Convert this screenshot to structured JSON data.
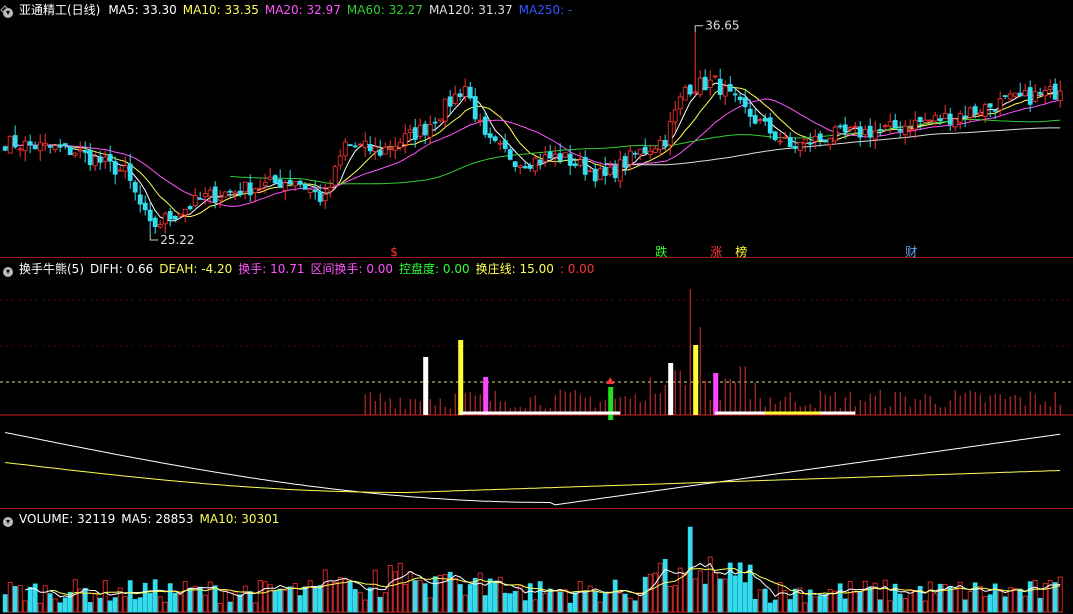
{
  "main": {
    "title": "亚通精工(日线)",
    "ma_labels": [
      {
        "label": "MA5: 33.30",
        "color": "#ffffff"
      },
      {
        "label": "MA10: 33.35",
        "color": "#ffff55"
      },
      {
        "label": "MA20: 32.97",
        "color": "#ff55ff"
      },
      {
        "label": "MA60: 32.27",
        "color": "#33cc33"
      },
      {
        "label": "MA120: 31.37",
        "color": "#dddddd"
      },
      {
        "label": "MA250: -",
        "color": "#3355ff"
      }
    ],
    "high_label": "36.65",
    "low_label": "25.22",
    "markers": [
      {
        "label": "$",
        "color": "#ff3333",
        "i": 78
      },
      {
        "label": "跌",
        "color": "#33ff33",
        "i": 131
      },
      {
        "label": "涨",
        "color": "#ff3333",
        "i": 142
      },
      {
        "label": "榜",
        "color": "#ffff33",
        "i": 147
      },
      {
        "label": "财",
        "color": "#66aaff",
        "i": 181
      }
    ]
  },
  "indicator": {
    "name": "换手牛熊(5)",
    "labels": [
      {
        "label": "DIFH: 0.66",
        "color": "#ffffff"
      },
      {
        "label": "DEAH: -4.20",
        "color": "#ffff55"
      },
      {
        "label": "换手: 10.71",
        "color": "#ff55ff"
      },
      {
        "label": "区间换手: 0.00",
        "color": "#ff55ff"
      },
      {
        "label": "控盘度: 0.00",
        "color": "#33ff33"
      },
      {
        "label": "换庄线: 15.00",
        "color": "#ffff55"
      },
      {
        "label": ": 0.00",
        "color": "#ff3333"
      }
    ]
  },
  "volume": {
    "labels": [
      {
        "label": "VOLUME: 32119",
        "color": "#ffffff"
      },
      {
        "label": "MA5: 28853",
        "color": "#ffffff"
      },
      {
        "label": "MA10: 30301",
        "color": "#ffff55"
      }
    ]
  },
  "icons": {
    "collapse": "chevron-down-icon",
    "scroll": "chevron-up-icon"
  },
  "chart_data": {
    "type": "candlestick",
    "title": "亚通精工(日线)",
    "bars": 212,
    "price_range": [
      25.22,
      36.65
    ],
    "anchors": [
      {
        "i": 0,
        "close": 30.4
      },
      {
        "i": 14,
        "close": 29.9
      },
      {
        "i": 24,
        "close": 28.7
      },
      {
        "i": 29,
        "close": 25.6
      },
      {
        "i": 40,
        "close": 27.3
      },
      {
        "i": 50,
        "close": 27.9
      },
      {
        "i": 58,
        "close": 28.3
      },
      {
        "i": 64,
        "close": 27.1
      },
      {
        "i": 68,
        "close": 30.3
      },
      {
        "i": 75,
        "close": 29.9
      },
      {
        "i": 84,
        "close": 31.2
      },
      {
        "i": 92,
        "close": 33.6
      },
      {
        "i": 96,
        "close": 30.5
      },
      {
        "i": 103,
        "close": 29.3
      },
      {
        "i": 111,
        "close": 29.6
      },
      {
        "i": 120,
        "close": 28.4
      },
      {
        "i": 126,
        "close": 29.7
      },
      {
        "i": 132,
        "close": 30.6
      },
      {
        "i": 136,
        "close": 33.5
      },
      {
        "i": 142,
        "close": 33.8
      },
      {
        "i": 147,
        "close": 32.4
      },
      {
        "i": 157,
        "close": 30.1
      },
      {
        "i": 165,
        "close": 30.8
      },
      {
        "i": 176,
        "close": 31.1
      },
      {
        "i": 182,
        "close": 31.5
      },
      {
        "i": 190,
        "close": 31.9
      },
      {
        "i": 200,
        "close": 32.7
      },
      {
        "i": 211,
        "close": 33.3
      }
    ],
    "volume_last": 32119,
    "turnover_last": 10.71
  }
}
